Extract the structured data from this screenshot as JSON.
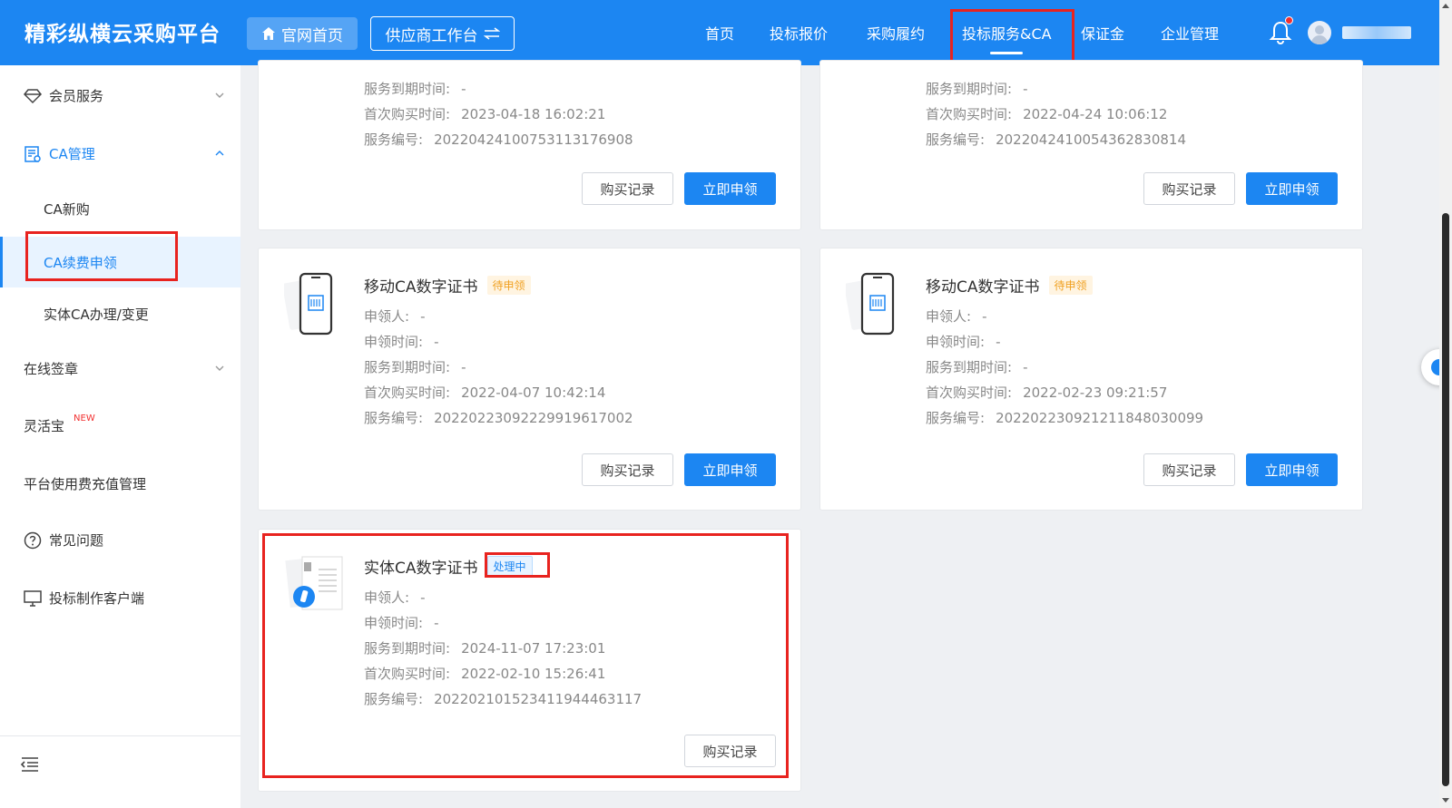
{
  "header": {
    "brand": "精彩纵横云采购平台",
    "home_button": "官网首页",
    "workbench_button": "供应商工作台",
    "nav": [
      "首页",
      "投标报价",
      "采购履约",
      "投标服务&CA",
      "保证金",
      "企业管理"
    ],
    "active_nav": "投标服务&CA"
  },
  "sidebar": {
    "member": "会员服务",
    "ca_manage": "CA管理",
    "ca_new": "CA新购",
    "ca_renew": "CA续费申领",
    "ca_physical": "实体CA办理/变更",
    "online_sign": "在线签章",
    "linghuobao": "灵活宝",
    "new_badge": "NEW",
    "platform_fee": "平台使用费充值管理",
    "faq": "常见问题",
    "client": "投标制作客户端"
  },
  "labels": {
    "applicant": "申领人:",
    "apply_time": "申领时间:",
    "expire": "服务到期时间:",
    "first_buy": "首次购买时间:",
    "service_no": "服务编号:",
    "buy_record": "购买记录",
    "apply_now": "立即申领"
  },
  "cards": [
    {
      "expire": "-",
      "first_buy": "2023-04-18 16:02:21",
      "service_no": "20220424100753113176908"
    },
    {
      "expire": "-",
      "first_buy": "2022-04-24 10:06:12",
      "service_no": "20220424100543628308​14"
    },
    {
      "title": "移动CA数字证书",
      "status": "待申领",
      "applicant": "-",
      "apply_time": "-",
      "expire": "-",
      "first_buy": "2022-04-07 10:42:14",
      "service_no": "20220223092229919617002"
    },
    {
      "title": "移动CA数字证书",
      "status": "待申领",
      "applicant": "-",
      "apply_time": "-",
      "expire": "-",
      "first_buy": "2022-02-23 09:21:57",
      "service_no": "20220223092121184803009​9"
    },
    {
      "title": "实体CA数字证书",
      "status": "处理中",
      "applicant": "-",
      "apply_time": "-",
      "expire": "2024-11-07 17:23:01",
      "first_buy": "2022-02-10 15:26:41",
      "service_no": "20220210152341194446311​7"
    }
  ],
  "colors": {
    "primary": "#1c86f2",
    "highlight": "#e8231f",
    "pending": "#f0a020"
  }
}
